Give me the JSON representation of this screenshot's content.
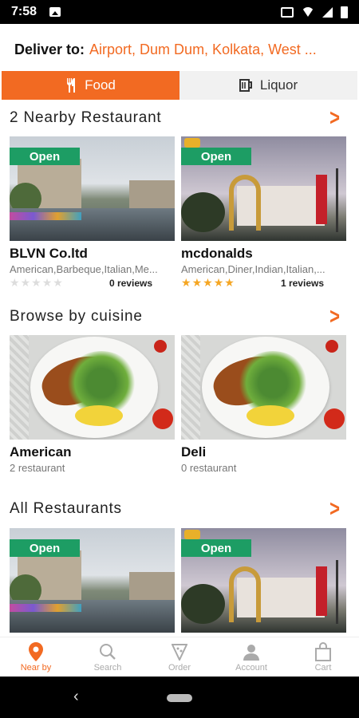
{
  "status": {
    "time": "7:58"
  },
  "deliver": {
    "label": "Deliver to:",
    "address": "Airport, Dum Dum, Kolkata, West ..."
  },
  "tabs": [
    {
      "label": "Food",
      "icon": "fork-knife-icon",
      "active": true
    },
    {
      "label": "Liquor",
      "icon": "beer-mug-icon",
      "active": false
    }
  ],
  "nearby": {
    "title": "2 Nearby Restaurant",
    "items": [
      {
        "status": "Open",
        "name": "BLVN Co.ltd",
        "cuisines": "American,Barbeque,Italian,Me...",
        "rating": 0,
        "reviews": "0 reviews"
      },
      {
        "status": "Open",
        "name": "mcdonalds",
        "cuisines": "American,Diner,Indian,Italian,...",
        "rating": 5,
        "reviews": "1 reviews"
      }
    ]
  },
  "cuisines": {
    "title": "Browse by cuisine",
    "items": [
      {
        "name": "American",
        "count": "2 restaurant"
      },
      {
        "name": "Deli",
        "count": "0 restaurant"
      }
    ]
  },
  "all": {
    "title": "All Restaurants",
    "items": [
      {
        "status": "Open"
      },
      {
        "status": "Open"
      }
    ]
  },
  "bottom_nav": [
    {
      "label": "Near by",
      "icon": "location-pin-icon",
      "active": true
    },
    {
      "label": "Search",
      "icon": "search-icon",
      "active": false
    },
    {
      "label": "Order",
      "icon": "pizza-icon",
      "active": false
    },
    {
      "label": "Account",
      "icon": "user-icon",
      "active": false
    },
    {
      "label": "Cart",
      "icon": "cart-bag-icon",
      "active": false
    }
  ],
  "colors": {
    "accent": "#f26a22",
    "open_badge": "#1d9d64",
    "star_filled": "#f5a623",
    "star_empty": "#dddddd"
  }
}
